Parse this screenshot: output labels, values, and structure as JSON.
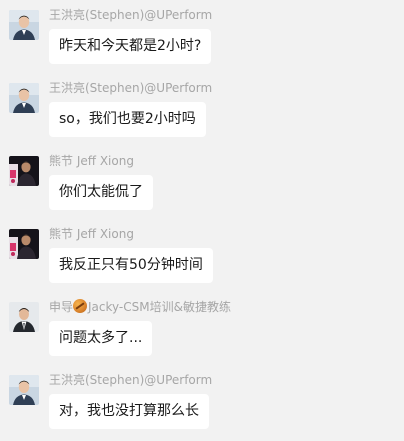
{
  "messages": [
    {
      "sender": "王洪亮(Stephen)@UPerform",
      "avatar": "avatar-stephen",
      "text": "昨天和今天都是2小时?"
    },
    {
      "sender": "王洪亮(Stephen)@UPerform",
      "avatar": "avatar-stephen",
      "text": "so，我们也要2小时吗"
    },
    {
      "sender": "熊节 Jeff Xiong",
      "avatar": "avatar-jeff",
      "text": "你们太能侃了"
    },
    {
      "sender": "熊节 Jeff Xiong",
      "avatar": "avatar-jeff",
      "text": "我反正只有50分钟时间"
    },
    {
      "sender_prefix": "申导",
      "sender_emoji": "rugby-ball-icon",
      "sender_suffix": "Jacky-CSM培训&敏捷教练",
      "avatar": "avatar-jacky",
      "text": "问题太多了..."
    },
    {
      "sender": "王洪亮(Stephen)@UPerform",
      "avatar": "avatar-stephen",
      "text": "对，我也没打算那么长"
    }
  ],
  "colors": {
    "background": "#f2f2f2",
    "bubble": "#ffffff",
    "sender_name": "#a6a6a6",
    "message_text": "#1a1a1a"
  }
}
